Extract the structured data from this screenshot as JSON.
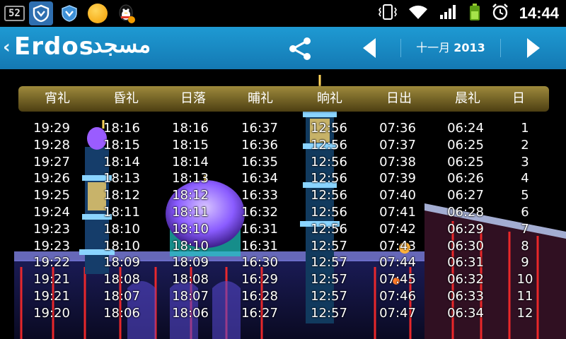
{
  "status_bar": {
    "badge": "52",
    "time": "14:44"
  },
  "header": {
    "brand": "Erdos",
    "brand_arabic": "مسجد",
    "month_label": "十一月",
    "year": "2013"
  },
  "columns": [
    "宵礼",
    "昏礼",
    "日落",
    "晡礼",
    "晌礼",
    "日出",
    "晨礼",
    "日"
  ],
  "rows": [
    [
      "19:29",
      "18:16",
      "18:16",
      "16:37",
      "12:56",
      "07:36",
      "06:24",
      "1"
    ],
    [
      "19:28",
      "18:15",
      "18:15",
      "16:36",
      "12:56",
      "07:37",
      "06:25",
      "2"
    ],
    [
      "19:27",
      "18:14",
      "18:14",
      "16:35",
      "12:56",
      "07:38",
      "06:25",
      "3"
    ],
    [
      "19:26",
      "18:13",
      "18:13",
      "16:34",
      "12:56",
      "07:39",
      "06:26",
      "4"
    ],
    [
      "19:25",
      "18:12",
      "18:12",
      "16:33",
      "12:56",
      "07:40",
      "06:27",
      "5"
    ],
    [
      "19:24",
      "18:11",
      "18:11",
      "16:32",
      "12:56",
      "07:41",
      "06:28",
      "6"
    ],
    [
      "19:23",
      "18:10",
      "18:10",
      "16:31",
      "12:56",
      "07:42",
      "06:29",
      "7"
    ],
    [
      "19:23",
      "18:10",
      "18:10",
      "16:31",
      "12:57",
      "07:43",
      "06:30",
      "8"
    ],
    [
      "19:22",
      "18:09",
      "18:09",
      "16:30",
      "12:57",
      "07:44",
      "06:31",
      "9"
    ],
    [
      "19:21",
      "18:08",
      "18:08",
      "16:29",
      "12:57",
      "07:45",
      "06:32",
      "10"
    ],
    [
      "19:21",
      "18:07",
      "18:07",
      "16:28",
      "12:57",
      "07:46",
      "06:33",
      "11"
    ],
    [
      "19:20",
      "18:06",
      "18:06",
      "16:27",
      "12:57",
      "07:47",
      "06:34",
      "12"
    ]
  ],
  "colors": {
    "header_blue": "#1e9ad3",
    "table_head_gold": "#9e8a3c",
    "dome_purple": "#8a5cff",
    "neon_red": "#ff2a2a"
  }
}
